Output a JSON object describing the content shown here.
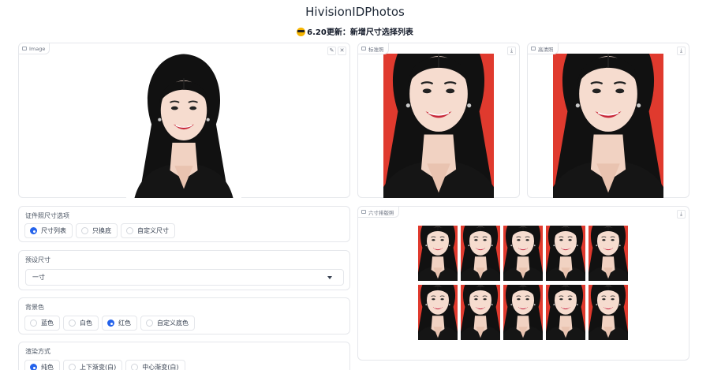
{
  "app": {
    "title": "HivisionIDPhotos",
    "subtitle": "6.20更新：新增尺寸选择列表"
  },
  "colors": {
    "background_red": "#e03a2e",
    "accent_blue": "#2563eb",
    "border": "#e5e7eb"
  },
  "input_panel": {
    "label": "Image",
    "edit_icon": "pencil-icon",
    "close_icon": "close-icon"
  },
  "standard_panel": {
    "label": "标准照",
    "download_icon": "download-icon"
  },
  "hd_panel": {
    "label": "高清照",
    "download_icon": "download-icon"
  },
  "layout_panel": {
    "label": "六寸排版照",
    "download_icon": "download-icon",
    "rows": 2,
    "cols": 5
  },
  "size_options": {
    "label": "证件照尺寸选项",
    "options": [
      "尺寸列表",
      "只换底",
      "自定义尺寸"
    ],
    "selected": 0
  },
  "preset_size": {
    "label": "预设尺寸",
    "value": "一寸"
  },
  "bg_color": {
    "label": "背景色",
    "options": [
      "蓝色",
      "白色",
      "红色",
      "自定义底色"
    ],
    "selected": 2
  },
  "render_mode": {
    "label": "渲染方式",
    "options": [
      "纯色",
      "上下渐变(白)",
      "中心渐变(白)"
    ],
    "selected": 0
  }
}
